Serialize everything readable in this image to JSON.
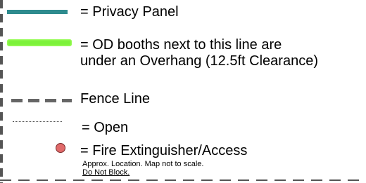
{
  "legend": {
    "items": [
      {
        "symbol": "privacy-panel-line",
        "color": "#2e8b8e",
        "label": "= Privacy Panel"
      },
      {
        "symbol": "overhang-highlight",
        "color": "#7cf23a",
        "label_line1": "= OD booths next to this line are",
        "label_line2": "under an Overhang (12.5ft Clearance)"
      },
      {
        "symbol": "fence-dashed-line",
        "color": "#666666",
        "label": "Fence Line"
      },
      {
        "symbol": "open-dotted-line",
        "color": "#444444",
        "label": "= Open"
      },
      {
        "symbol": "fire-extinguisher-dot",
        "color": "#e06a6a",
        "label": "= Fire Extinguisher/Access"
      }
    ],
    "note_line1": "Approx. Location. Map not to scale.",
    "note_line2": "Do Not Block."
  }
}
